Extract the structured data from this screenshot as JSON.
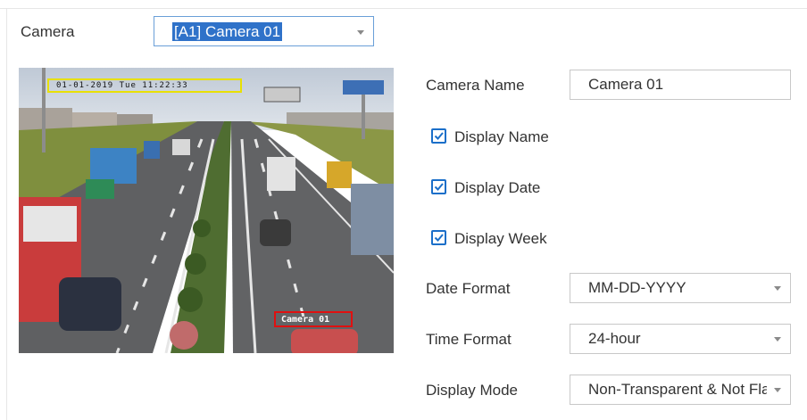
{
  "camera_select": {
    "label": "Camera",
    "selected": "[A1] Camera 01"
  },
  "preview": {
    "osd_date": "01-01-2019 Tue 11:22:33",
    "osd_name": "Camera 01"
  },
  "form": {
    "camera_name": {
      "label": "Camera Name",
      "value": "Camera 01"
    },
    "display_name": {
      "label": "Display Name",
      "checked": true
    },
    "display_date": {
      "label": "Display Date",
      "checked": true
    },
    "display_week": {
      "label": "Display Week",
      "checked": true
    },
    "date_format": {
      "label": "Date Format",
      "value": "MM-DD-YYYY"
    },
    "time_format": {
      "label": "Time Format",
      "value": "24-hour"
    },
    "display_mode": {
      "label": "Display Mode",
      "value": "Non-Transparent & Not Flashing"
    }
  },
  "colors": {
    "accent": "#1b6fc9",
    "osd_date_box": "#e8e000",
    "osd_name_box": "#e01010"
  }
}
